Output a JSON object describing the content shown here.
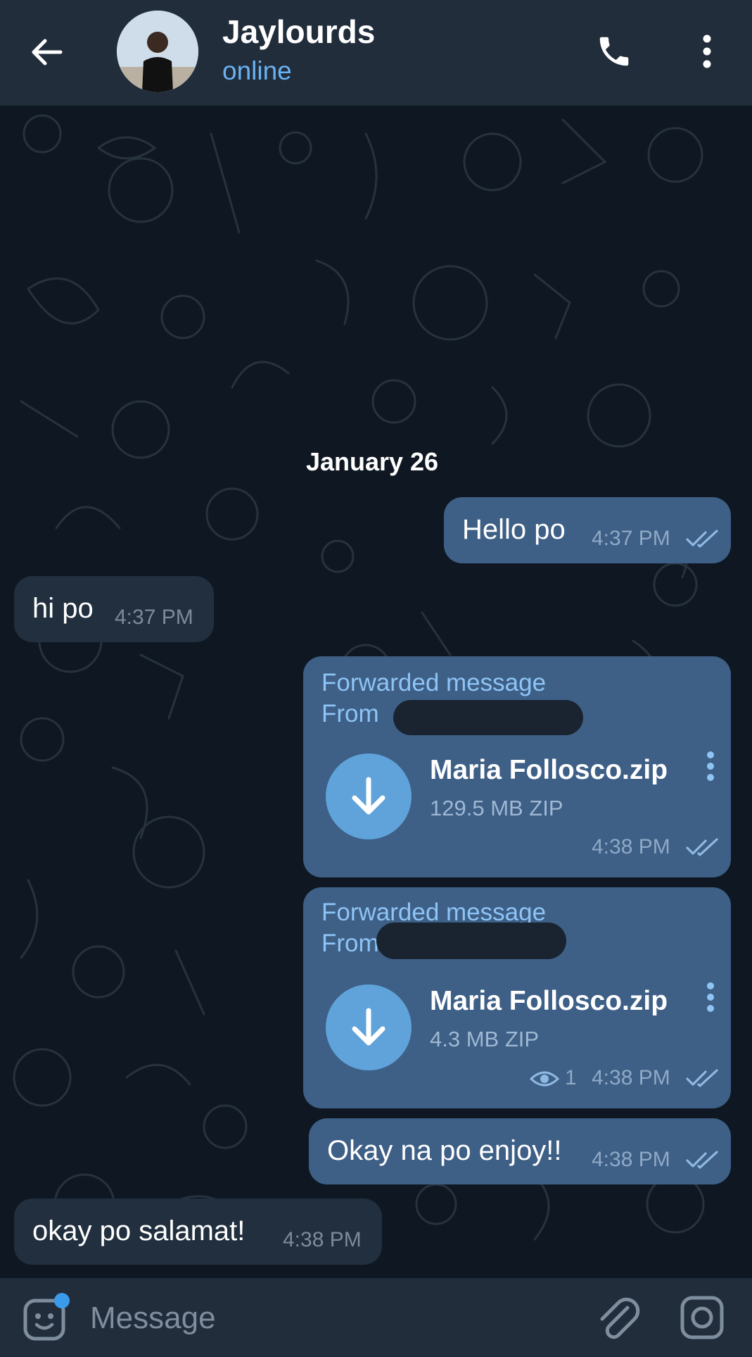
{
  "header": {
    "title": "Jaylourds",
    "status": "online",
    "avatar_icon": "profile-photo"
  },
  "chat": {
    "date": "January 26",
    "messages": [
      {
        "direction": "out",
        "text": "Hello po",
        "time": "4:37 PM",
        "read": true
      },
      {
        "direction": "in",
        "text": "hi po",
        "time": "4:37 PM"
      },
      {
        "direction": "out",
        "forwarded_label": "Forwarded message",
        "from_prefix": "From",
        "file_name": "Maria Follosco.zip",
        "file_size": "129.5 MB ZIP",
        "time": "4:38 PM",
        "read": true
      },
      {
        "direction": "out",
        "forwarded_label": "Forwarded message",
        "from_prefix": "From",
        "file_name": "Maria Follosco.zip",
        "file_size": "4.3 MB ZIP",
        "views": "1",
        "time": "4:38 PM",
        "read": true
      },
      {
        "direction": "out",
        "text": "Okay na po enjoy!!",
        "time": "4:38 PM",
        "read": true
      },
      {
        "direction": "in",
        "text": "okay po salamat!",
        "time": "4:38 PM"
      }
    ]
  },
  "composer": {
    "placeholder": "Message"
  },
  "colors": {
    "header_bg": "#212d3b",
    "chat_bg": "#0f1822",
    "outgoing_bubble": "#3e5f86",
    "incoming_bubble": "#212f3e",
    "accent": "#6ab2f2",
    "download_button": "#5fa3da"
  }
}
